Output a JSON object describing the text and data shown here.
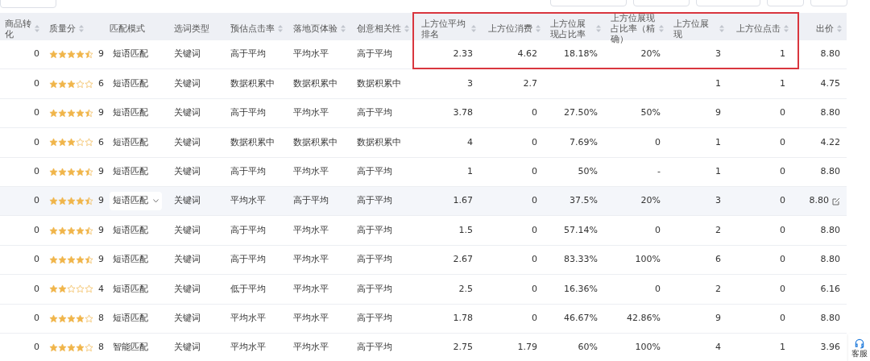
{
  "service_button": {
    "label": "客服"
  },
  "columns": [
    {
      "label": "商品转化",
      "sortable": true
    },
    {
      "label": "质量分",
      "sortable": true
    },
    {
      "label": "匹配模式",
      "sortable": false
    },
    {
      "label": "选词类型",
      "sortable": false
    },
    {
      "label": "预估点击率",
      "sortable": true
    },
    {
      "label": "落地页体验",
      "sortable": true
    },
    {
      "label": "创意相关性",
      "sortable": true
    },
    {
      "label": "上方位平均排名",
      "sortable": true
    },
    {
      "label": "上方位消费",
      "sortable": true
    },
    {
      "label": "上方位展现占比率",
      "sortable": true
    },
    {
      "label": "上方位展现占比率（精确）",
      "sortable": true
    },
    {
      "label": "上方位展现",
      "sortable": true
    },
    {
      "label": "上方位点击",
      "sortable": true
    },
    {
      "label": "出价",
      "sortable": true
    }
  ],
  "rows": [
    {
      "conversion": "0",
      "stars": 4.5,
      "score": "9",
      "match": "短语匹配",
      "type": "关键词",
      "ctr": "高于平均",
      "landing": "平均水平",
      "relevance": "高于平均",
      "avg_rank": "2.33",
      "cost": "4.62",
      "share": "18.18%",
      "share_exact": "20%",
      "impressions": "3",
      "clicks": "1",
      "bid": "8.80",
      "hovered": false
    },
    {
      "conversion": "0",
      "stars": 3,
      "score": "6",
      "match": "短语匹配",
      "type": "关键词",
      "ctr": "数据积累中",
      "landing": "数据积累中",
      "relevance": "数据积累中",
      "avg_rank": "3",
      "cost": "2.7",
      "impressions": "1",
      "clicks": "1",
      "bid": "4.75",
      "hovered": false
    },
    {
      "conversion": "0",
      "stars": 4.5,
      "score": "9",
      "match": "短语匹配",
      "type": "关键词",
      "ctr": "高于平均",
      "landing": "平均水平",
      "relevance": "高于平均",
      "avg_rank": "3.78",
      "cost": "0",
      "share": "27.50%",
      "share_exact": "50%",
      "impressions": "9",
      "clicks": "0",
      "bid": "8.80",
      "hovered": false
    },
    {
      "conversion": "0",
      "stars": 3,
      "score": "6",
      "match": "短语匹配",
      "type": "关键词",
      "ctr": "数据积累中",
      "landing": "数据积累中",
      "relevance": "数据积累中",
      "avg_rank": "4",
      "cost": "0",
      "share": "7.69%",
      "share_exact": "0",
      "impressions": "1",
      "clicks": "0",
      "bid": "4.22",
      "hovered": false
    },
    {
      "conversion": "0",
      "stars": 4.5,
      "score": "9",
      "match": "短语匹配",
      "type": "关键词",
      "ctr": "高于平均",
      "landing": "平均水平",
      "relevance": "高于平均",
      "avg_rank": "1",
      "cost": "0",
      "share": "50%",
      "share_exact": "-",
      "impressions": "1",
      "clicks": "0",
      "bid": "8.80",
      "hovered": false
    },
    {
      "conversion": "0",
      "stars": 4.5,
      "score": "9",
      "match": "短语匹配",
      "type": "关键词",
      "ctr": "平均水平",
      "landing": "高于平均",
      "relevance": "高于平均",
      "avg_rank": "1.67",
      "cost": "0",
      "share": "37.5%",
      "share_exact": "20%",
      "impressions": "3",
      "clicks": "0",
      "bid": "8.80",
      "hovered": true
    },
    {
      "conversion": "0",
      "stars": 4.5,
      "score": "9",
      "match": "短语匹配",
      "type": "关键词",
      "ctr": "高于平均",
      "landing": "平均水平",
      "relevance": "高于平均",
      "avg_rank": "1.5",
      "cost": "0",
      "share": "57.14%",
      "share_exact": "0",
      "impressions": "2",
      "clicks": "0",
      "bid": "8.80",
      "hovered": false
    },
    {
      "conversion": "0",
      "stars": 4.5,
      "score": "9",
      "match": "短语匹配",
      "type": "关键词",
      "ctr": "高于平均",
      "landing": "平均水平",
      "relevance": "高于平均",
      "avg_rank": "2.67",
      "cost": "0",
      "share": "83.33%",
      "share_exact": "100%",
      "impressions": "6",
      "clicks": "0",
      "bid": "8.80",
      "hovered": false
    },
    {
      "conversion": "0",
      "stars": 2,
      "score": "4",
      "match": "短语匹配",
      "type": "关键词",
      "ctr": "低于平均",
      "landing": "平均水平",
      "relevance": "高于平均",
      "avg_rank": "2.5",
      "cost": "0",
      "share": "16.36%",
      "share_exact": "0",
      "impressions": "2",
      "clicks": "0",
      "bid": "6.16",
      "hovered": false
    },
    {
      "conversion": "0",
      "stars": 4,
      "score": "8",
      "match": "短语匹配",
      "type": "关键词",
      "ctr": "平均水平",
      "landing": "平均水平",
      "relevance": "高于平均",
      "avg_rank": "1.78",
      "cost": "0",
      "share": "46.67%",
      "share_exact": "42.86%",
      "impressions": "9",
      "clicks": "0",
      "bid": "8.80",
      "hovered": false
    },
    {
      "conversion": "0",
      "stars": 4,
      "score": "8",
      "match": "智能匹配",
      "type": "关键词",
      "ctr": "平均水平",
      "landing": "平均水平",
      "relevance": "高于平均",
      "avg_rank": "2.75",
      "cost": "1.79",
      "share": "60%",
      "share_exact": "100%",
      "impressions": "4",
      "clicks": "1",
      "bid": "3.96",
      "hovered": false
    }
  ]
}
